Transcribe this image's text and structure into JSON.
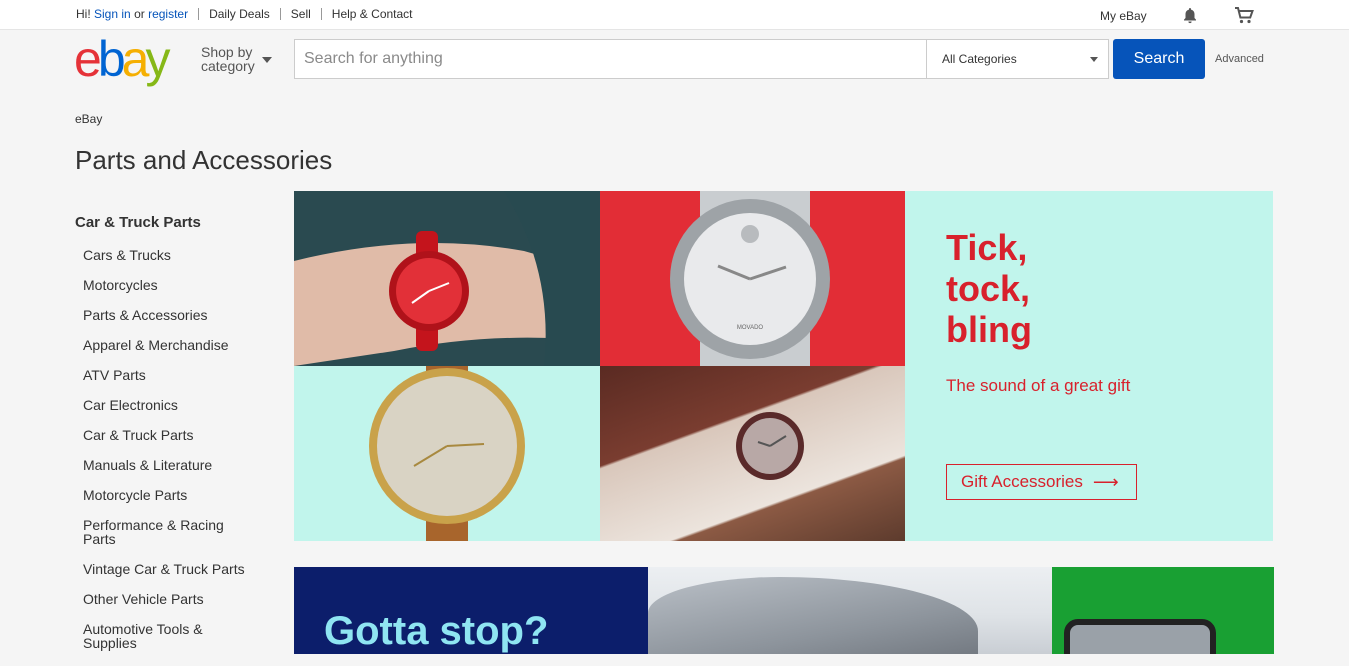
{
  "topbar": {
    "greeting": "Hi!",
    "sign_in": "Sign in",
    "or": "or",
    "register": "register",
    "links": [
      "Daily Deals",
      "Sell",
      "Help & Contact"
    ],
    "my_ebay": "My eBay"
  },
  "header": {
    "logo_letters": [
      "e",
      "b",
      "a",
      "y"
    ],
    "shop_by_line1": "Shop by",
    "shop_by_line2": "category",
    "search_placeholder": "Search for anything",
    "category_selected": "All Categories",
    "search_button": "Search",
    "advanced": "Advanced"
  },
  "breadcrumb": "eBay",
  "page_title": "Parts and Accessories",
  "sidebar": {
    "heading": "Car & Truck Parts",
    "items": [
      "Cars & Trucks",
      "Motorcycles",
      "Parts & Accessories",
      "Apparel & Merchandise",
      "ATV Parts",
      "Car Electronics",
      "Car & Truck Parts",
      "Manuals & Literature",
      "Motorcycle Parts",
      "Performance & Racing Parts",
      "Vintage Car & Truck Parts",
      "Other Vehicle Parts",
      "Automotive Tools & Supplies"
    ]
  },
  "hero": {
    "title": "Tick,\ntock,\nbling",
    "subtitle": "The sound of a great gift",
    "cta": "Gift Accessories",
    "brand_text": "MOVADO",
    "accent": "#d8212c",
    "background": "#c1f5ec"
  },
  "banner2": {
    "title": "Gotta stop?"
  },
  "icons": {
    "notifications": "bell-icon",
    "cart": "cart-icon"
  },
  "colors": {
    "link": "#0654ba",
    "search_button": "#0654ba",
    "logo": [
      "#e53238",
      "#0064d2",
      "#f5af02",
      "#86b817"
    ]
  }
}
